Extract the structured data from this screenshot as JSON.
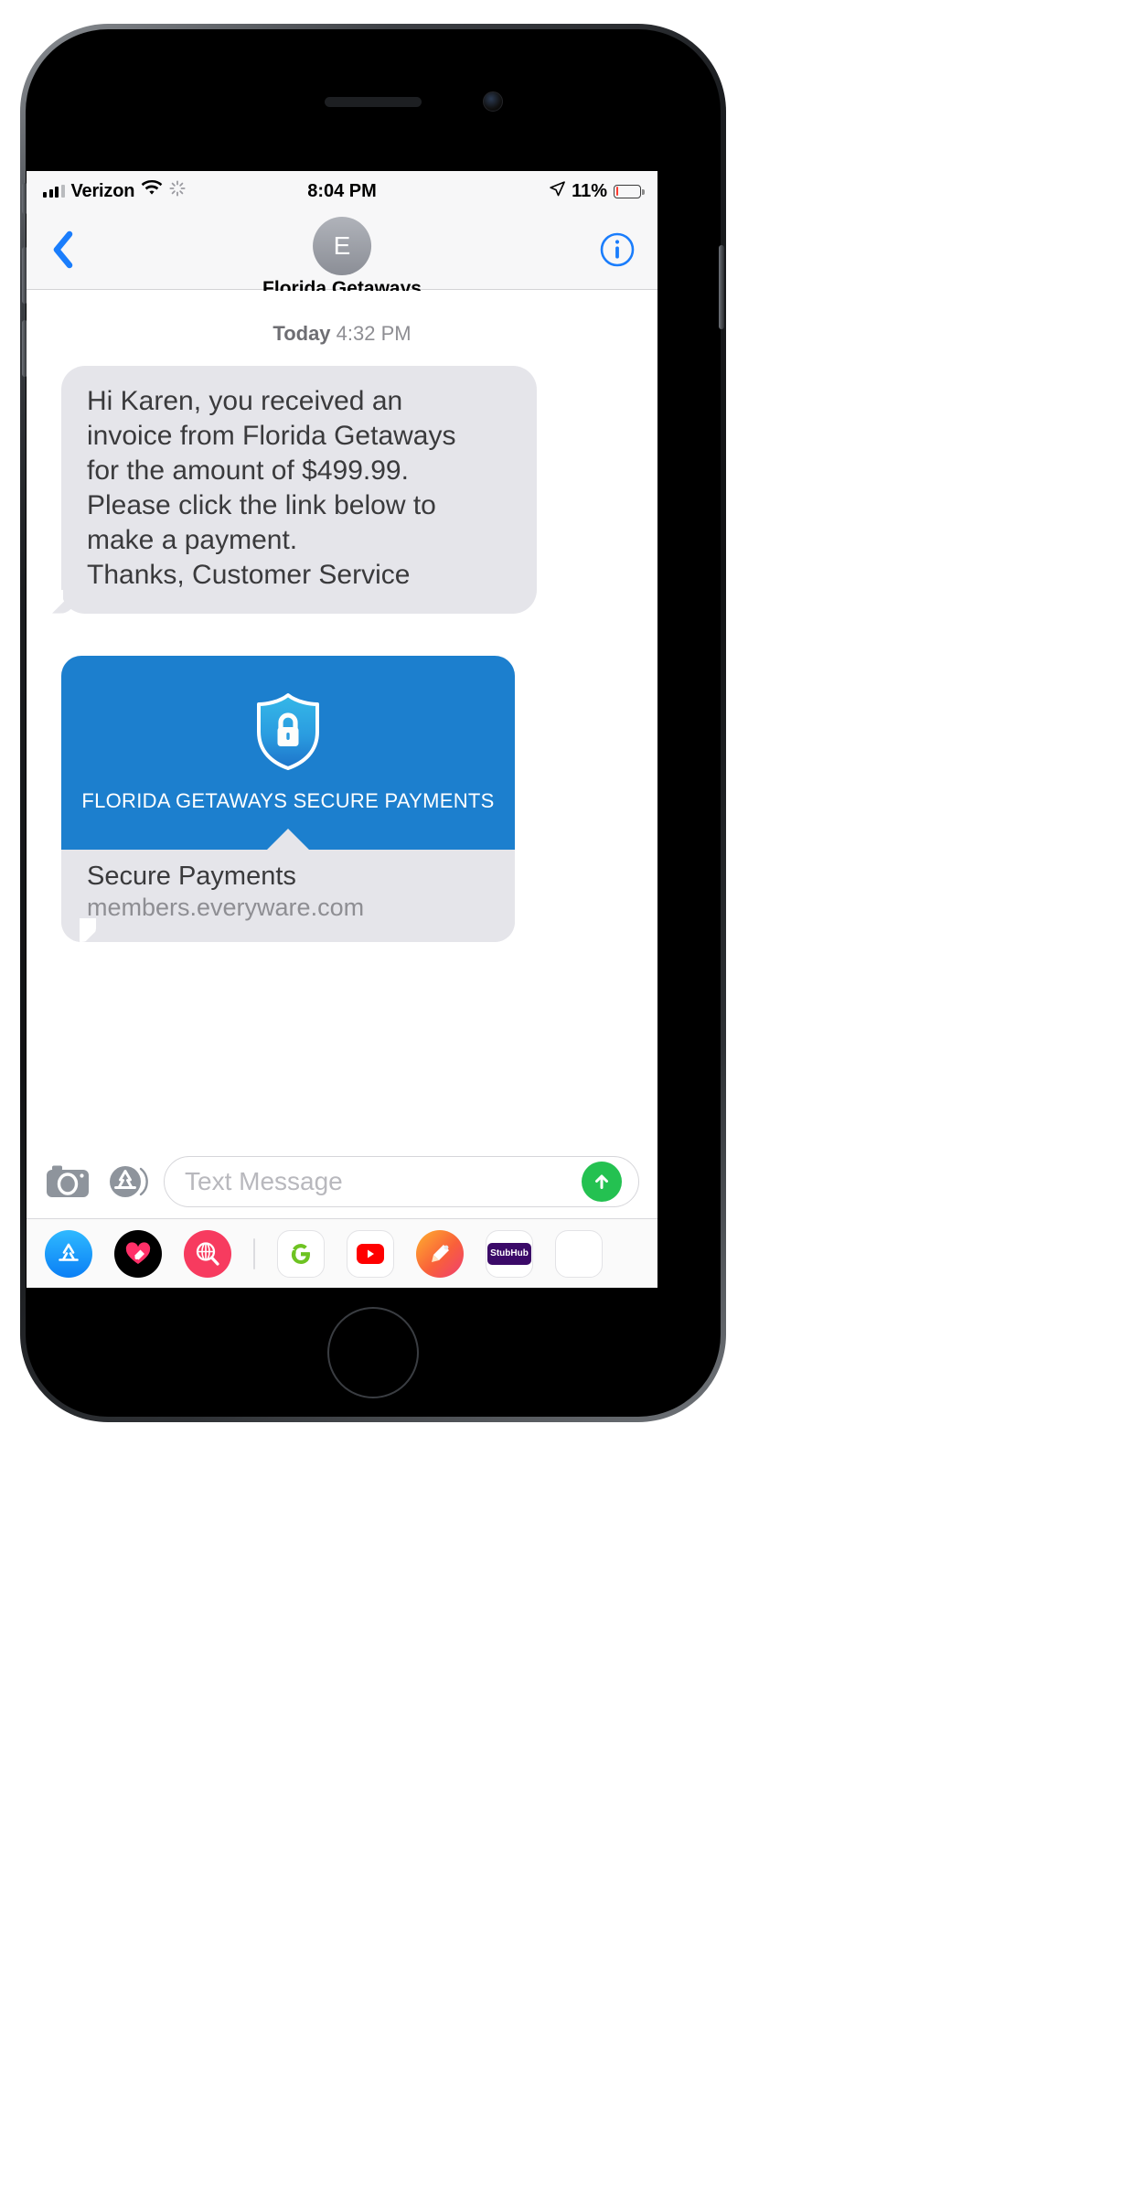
{
  "status_bar": {
    "carrier": "Verizon",
    "signal_icon": "signal-bars-icon",
    "wifi_icon": "wifi-icon",
    "activity_icon": "activity-spinner-icon",
    "time": "8:04 PM",
    "location_icon": "location-arrow-icon",
    "battery_percent": "11%",
    "battery_level": 11,
    "battery_color": "#ff3b30"
  },
  "nav_bar": {
    "back_icon": "chevron-left-icon",
    "avatar_initial": "E",
    "contact_name": "Florida Getaways",
    "info_icon": "info-circle-icon",
    "accent_color": "#1a7dfc"
  },
  "conversation": {
    "timestamp_day": "Today",
    "timestamp_time": "4:32 PM",
    "messages": [
      {
        "type": "text",
        "sender": "them",
        "lines": [
          "Hi Karen, you received an",
          "invoice from Florida Getaways",
          "for the amount of $499.99.",
          "Please click the link below to",
          "make a payment.",
          "Thanks, Customer Service"
        ]
      },
      {
        "type": "rich-link",
        "sender": "them",
        "hero_icon": "shield-lock-icon",
        "hero_title": "FLORIDA GETAWAYS SECURE PAYMENTS",
        "hero_bg_color": "#1c7fce",
        "link_title": "Secure Payments",
        "link_url": "members.everyware.com"
      }
    ]
  },
  "input_bar": {
    "camera_icon": "camera-icon",
    "appstore_icon": "app-store-icon",
    "placeholder": "Text Message",
    "send_icon": "send-arrow-up-icon",
    "send_color": "#24c151"
  },
  "app_drawer": {
    "apps": [
      {
        "name": "app-store",
        "icon": "app-store-icon",
        "color": "#1aa3ff"
      },
      {
        "name": "digital-touch",
        "icon": "heart-hand-icon",
        "color": "#000000"
      },
      {
        "name": "images-search",
        "icon": "globe-search-icon",
        "color": "#f73b5f"
      },
      {
        "name": "google",
        "icon": "google-g-icon",
        "color": "#ffffff"
      },
      {
        "name": "youtube",
        "icon": "youtube-icon",
        "color": "#ffffff"
      },
      {
        "name": "doodle",
        "icon": "doodle-hand-icon",
        "color": "#f9603a"
      },
      {
        "name": "stubhub",
        "icon": "stubhub-icon",
        "color": "#ffffff"
      }
    ]
  }
}
